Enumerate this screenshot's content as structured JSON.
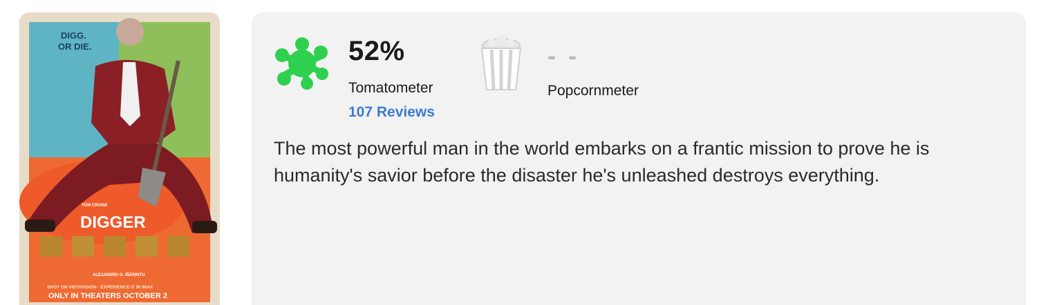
{
  "poster": {
    "tagline_line1": "DIGG.",
    "tagline_line2": "OR DIE.",
    "star_credit": "TOM CRUISE",
    "title": "DIGGER",
    "director": "ALEJANDRO G. IÑÁRRITU",
    "format": "SHOT ON VISTAVISION · EXPERIENCE IT IN IMAX",
    "release": "ONLY IN THEATERS OCTOBER 2"
  },
  "tomatometer": {
    "score": "52%",
    "label": "Tomatometer",
    "reviews": "107 Reviews",
    "icon": "green-splat-icon",
    "icon_color": "#2fd050"
  },
  "popcornmeter": {
    "score": "- -",
    "label": "Popcornmeter",
    "icon": "empty-popcorn-bucket-icon"
  },
  "synopsis": "The most powerful man in the world embarks on a frantic mission to prove he is humanity's savior before the disaster he's unleashed destroys everything.",
  "colors": {
    "link": "#3d7bd0",
    "card_bg": "#f2f2f2",
    "text": "#1a1a1a"
  }
}
